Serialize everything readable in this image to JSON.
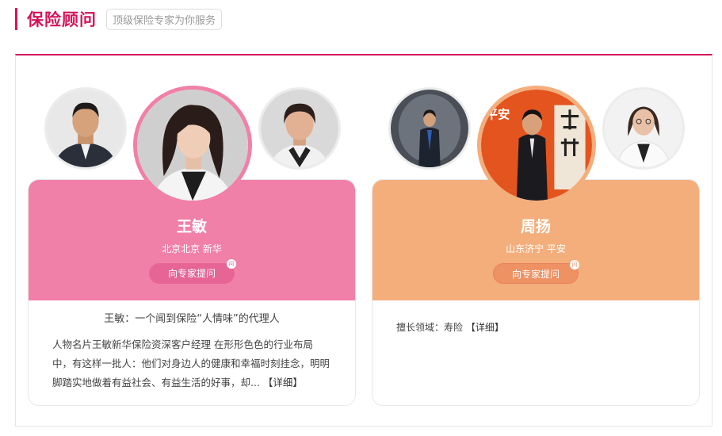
{
  "header": {
    "title": "保险顾问",
    "subtitle": "顶级保险专家为你服务"
  },
  "cards": [
    {
      "name": "王敏",
      "location": "北京北京 新华",
      "ask_label": "向专家提问",
      "intro_title": "王敏：一个闻到保险“人情味”的代理人",
      "intro_text": "人物名片王敏新华保险资深客户经理 在形形色色的行业布局中，有这样一批人：他们对身边人的健康和幸福时刻挂念，明明脚踏实地做着有益社会、有益生活的好事，却...",
      "detail_label": "【详细】",
      "accent": "#f080a8"
    },
    {
      "name": "周扬",
      "location": "山东济宁 平安",
      "ask_label": "向专家提问",
      "expertise": "擅长领域：寿险",
      "detail_label": "【详细】",
      "accent": "#f3ae7c"
    }
  ],
  "badge_glyph": "问"
}
